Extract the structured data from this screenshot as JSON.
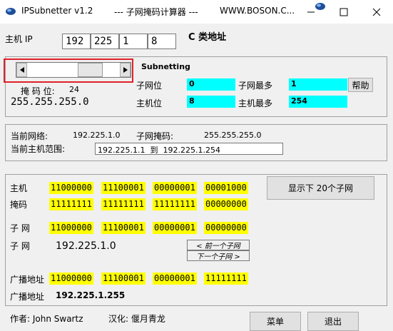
{
  "window": {
    "title": "IPSubnetter v1.2",
    "subtitle": "--- 子网掩码计算器 ---",
    "url": "WWW.BOSON.C..."
  },
  "ip": {
    "label": "主机 IP",
    "octets": [
      "192",
      "225",
      "1",
      "8"
    ],
    "class_label": "C 类地址"
  },
  "subnetting": {
    "title": "Subnetting",
    "mask_bits_label": "掩 码 位:",
    "mask_bits_value": "24",
    "mask": "255.255.255.0",
    "subnet_bits_label": "子网位",
    "subnet_bits_value": "0",
    "max_subnets_label": "子网最多",
    "max_subnets_value": "1",
    "host_bits_label": "主机位",
    "host_bits_value": "8",
    "max_hosts_label": "主机最多",
    "max_hosts_value": "254",
    "help_button": "帮助",
    "slider_level": 0.75
  },
  "network": {
    "current_network_label": "当前网络:",
    "current_network_value": "192.225.1.0",
    "subnet_mask_label": "子网掩码:",
    "subnet_mask_value": "255.255.255.0",
    "host_range_label": "当前主机范围:",
    "host_range_value": "192.225.1.1  到  192.225.1.254"
  },
  "binary": {
    "host_label": "主机",
    "host_bits": [
      "11000000",
      "11100001",
      "00000001",
      "00001000"
    ],
    "mask_label": "掩码",
    "mask_bits": [
      "11111111",
      "11111111",
      "11111111",
      "00000000"
    ],
    "subnet_label": "子 网",
    "subnet_bits": [
      "11000000",
      "11100001",
      "00000001",
      "00000000"
    ],
    "subnet_label2": "子 网",
    "subnet_value": "192.225.1.0",
    "prev_subnet": "< 前一个子网",
    "next_subnet": "下一个子网 >",
    "broadcast_label": "广播地址",
    "broadcast_bits": [
      "11000000",
      "11100001",
      "00000001",
      "11111111"
    ],
    "broadcast_label2": "广播地址",
    "broadcast_value": "192.225.1.255",
    "show_subnets_button": "显示下 20个子网"
  },
  "footer": {
    "author": "作者: John Swartz",
    "translator": "汉化: 偃月青龙",
    "menu_button": "菜单",
    "exit_button": "退出"
  },
  "colors": {
    "highlight_border": "#e0202a",
    "cyan": "#00ffff",
    "yellow": "#ffff00"
  }
}
